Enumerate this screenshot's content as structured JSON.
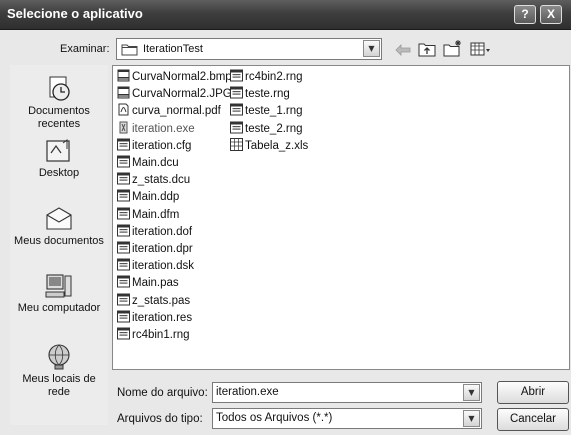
{
  "window": {
    "title": "Selecione o aplicativo",
    "help_label": "?",
    "close_label": "X"
  },
  "toolbar": {
    "lookin_label": "Examinar:",
    "lookin_value": "IterationTest",
    "icons": [
      "back-arrow-icon",
      "up-folder-icon",
      "new-folder-icon",
      "view-menu-icon"
    ]
  },
  "places": [
    {
      "label": "Documentos recentes",
      "icon": "recent-documents-icon"
    },
    {
      "label": "Desktop",
      "icon": "desktop-icon"
    },
    {
      "label": "Meus documentos",
      "icon": "my-documents-icon"
    },
    {
      "label": "Meu computador",
      "icon": "my-computer-icon"
    },
    {
      "label": "Meus locais de rede",
      "icon": "network-places-icon"
    }
  ],
  "files": {
    "column1": [
      {
        "name": "CurvaNormal2.bmp",
        "icon": "bmp-file-icon"
      },
      {
        "name": "CurvaNormal2.JPG",
        "icon": "jpg-file-icon"
      },
      {
        "name": "curva_normal.pdf",
        "icon": "pdf-file-icon"
      },
      {
        "name": "iteration.exe",
        "icon": "exe-file-icon"
      },
      {
        "name": "iteration.cfg",
        "icon": "generic-file-icon"
      },
      {
        "name": "Main.dcu",
        "icon": "generic-file-icon"
      },
      {
        "name": "z_stats.dcu",
        "icon": "generic-file-icon"
      },
      {
        "name": "Main.ddp",
        "icon": "generic-file-icon"
      },
      {
        "name": "Main.dfm",
        "icon": "generic-file-icon"
      },
      {
        "name": "iteration.dof",
        "icon": "generic-file-icon"
      },
      {
        "name": "iteration.dpr",
        "icon": "generic-file-icon"
      },
      {
        "name": "iteration.dsk",
        "icon": "generic-file-icon"
      },
      {
        "name": "Main.pas",
        "icon": "generic-file-icon"
      },
      {
        "name": "z_stats.pas",
        "icon": "generic-file-icon"
      },
      {
        "name": "iteration.res",
        "icon": "generic-file-icon"
      },
      {
        "name": "rc4bin1.rng",
        "icon": "generic-file-icon"
      }
    ],
    "column2": [
      {
        "name": "rc4bin2.rng",
        "icon": "generic-file-icon"
      },
      {
        "name": "teste.rng",
        "icon": "generic-file-icon"
      },
      {
        "name": "teste_1.rng",
        "icon": "generic-file-icon"
      },
      {
        "name": "teste_2.rng",
        "icon": "generic-file-icon"
      },
      {
        "name": "Tabela_z.xls",
        "icon": "xls-file-icon"
      }
    ]
  },
  "filename": {
    "label": "Nome do arquivo:",
    "value": "iteration.exe"
  },
  "filetype": {
    "label": "Arquivos do tipo:",
    "value": "Todos os Arquivos (*.*)"
  },
  "buttons": {
    "open": "Abrir",
    "cancel": "Cancelar"
  }
}
